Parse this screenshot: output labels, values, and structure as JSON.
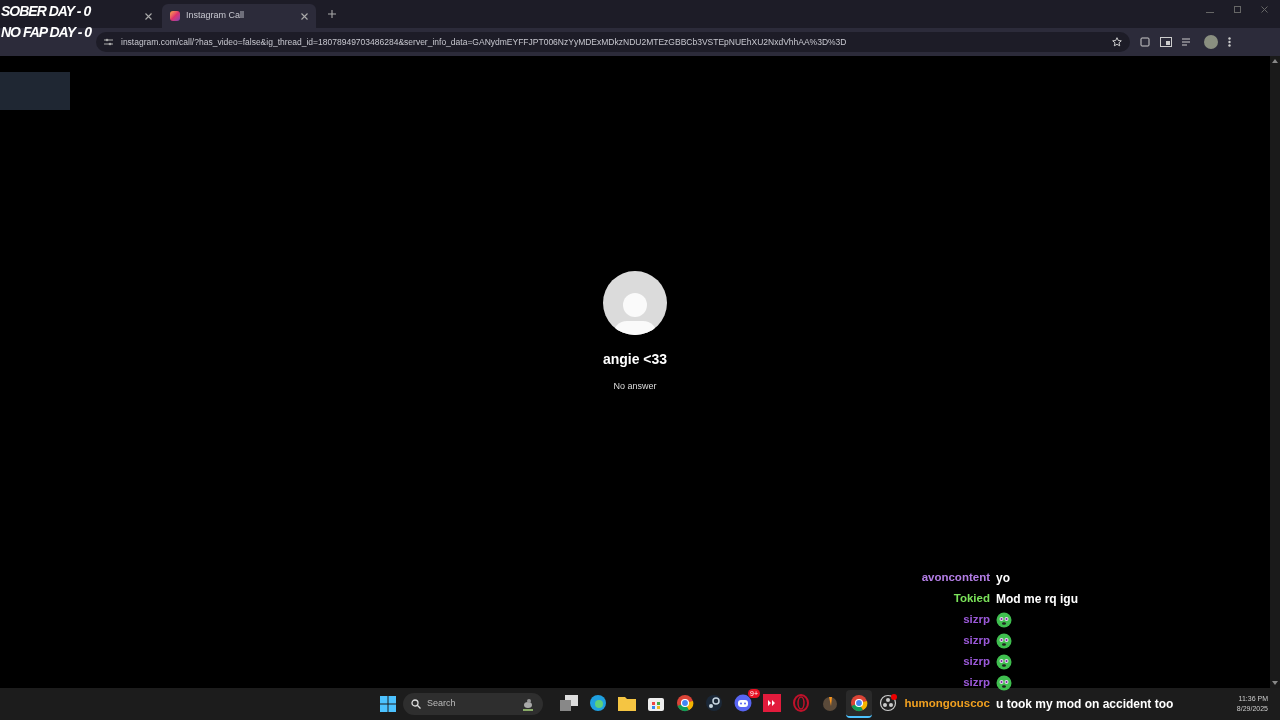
{
  "overlay": {
    "lines": [
      "SOBER DAY - 0",
      "NO FAP DAY - 0"
    ]
  },
  "browser": {
    "tabs": [
      {
        "selected": false
      },
      {
        "title": "Instagram Call",
        "selected": true
      }
    ],
    "address": "instagram.com/call/?has_video=false&ig_thread_id=18078949703486284&server_info_data=GANydmEYFFJPT006NzYyMDExMDkzNDU2MTEzGBBCb3VSTEpNUEhXU2NxdVhhAA%3D%3D"
  },
  "call": {
    "name": "angie <33",
    "status": "No answer"
  },
  "chat": [
    {
      "user": "avoncontent",
      "color": "#b47ee6",
      "kind": "text",
      "message": "yo"
    },
    {
      "user": "Tokied",
      "color": "#7be35a",
      "kind": "text",
      "message": "Mod me rq igu"
    },
    {
      "user": "sizrp",
      "color": "#9b59d9",
      "kind": "emote"
    },
    {
      "user": "sizrp",
      "color": "#9b59d9",
      "kind": "emote"
    },
    {
      "user": "sizrp",
      "color": "#9b59d9",
      "kind": "emote"
    },
    {
      "user": "sizrp",
      "color": "#9b59d9",
      "kind": "emote"
    },
    {
      "user": "humongouscoc",
      "color": "#f0a020",
      "kind": "text",
      "message": "u took my mod on accident too"
    }
  ],
  "taskbar": {
    "search_placeholder": "Search",
    "time": "11:36 PM",
    "date": "8/29/2025",
    "apps": [
      {
        "kind": "taskview",
        "selected": false
      },
      {
        "kind": "edge",
        "selected": false
      },
      {
        "kind": "folder",
        "selected": false
      },
      {
        "kind": "store",
        "selected": false
      },
      {
        "kind": "chrome",
        "selected": false
      },
      {
        "kind": "steam",
        "selected": false
      },
      {
        "kind": "discord",
        "selected": false,
        "badge": "9+"
      },
      {
        "kind": "red",
        "selected": false
      },
      {
        "kind": "opera",
        "selected": false
      },
      {
        "kind": "fl",
        "selected": false
      },
      {
        "kind": "chrome",
        "selected": true
      },
      {
        "kind": "obs",
        "selected": false
      }
    ]
  }
}
